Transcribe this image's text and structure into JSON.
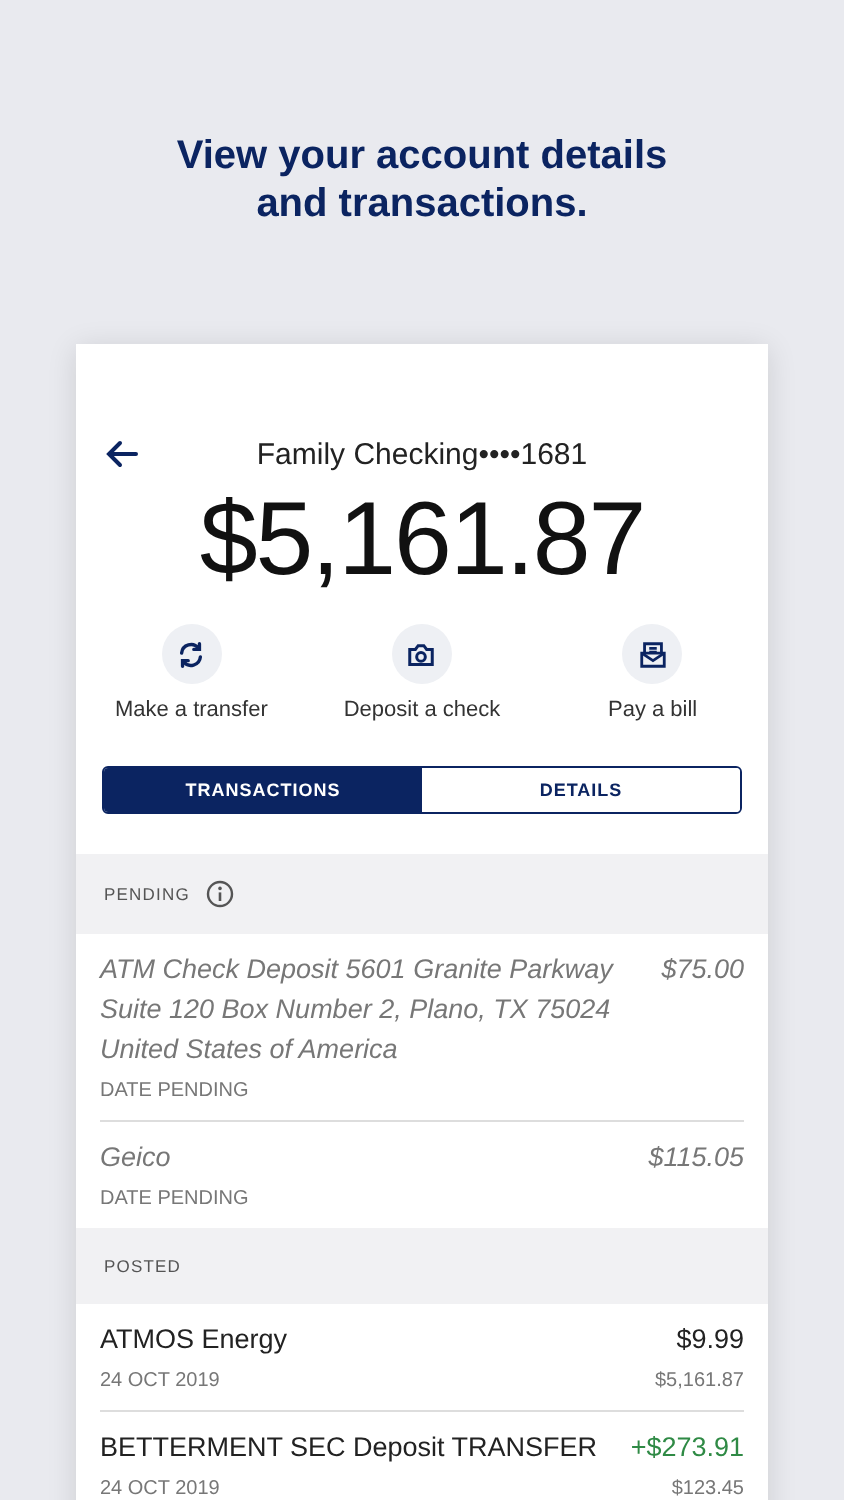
{
  "headline": "View your account details and transactions.",
  "account": {
    "name": "Family Checking••••1681",
    "balance": "$5,161.87"
  },
  "actions": [
    {
      "kind": "transfer",
      "label": "Make a transfer"
    },
    {
      "kind": "camera",
      "label": "Deposit a check"
    },
    {
      "kind": "bill",
      "label": "Pay a bill"
    }
  ],
  "tabs": [
    {
      "label": "TRANSACTIONS",
      "selected": true
    },
    {
      "label": "DETAILS",
      "selected": false
    }
  ],
  "sections": [
    {
      "title": "PENDING",
      "info": true,
      "transactions": [
        {
          "kind": "pending",
          "description": "ATM Check Deposit 5601 Granite Parkway Suite 120 Box Number 2, Plano, TX 75024 United States of America",
          "amount": "$75.00",
          "date": "DATE PENDING",
          "credit": false
        },
        {
          "kind": "pending",
          "description": "Geico",
          "amount": "$115.05",
          "date": "DATE PENDING",
          "credit": false
        }
      ]
    },
    {
      "title": "POSTED",
      "info": false,
      "transactions": [
        {
          "kind": "posted",
          "description": "ATMOS Energy",
          "amount": "$9.99",
          "date": "24 OCT 2019",
          "balance": "$5,161.87",
          "credit": false
        },
        {
          "kind": "posted",
          "description": "BETTERMENT SEC Deposit TRANSFER",
          "amount": "+$273.91",
          "date": "24 OCT 2019",
          "balance": "$123.45",
          "credit": true
        }
      ]
    }
  ]
}
